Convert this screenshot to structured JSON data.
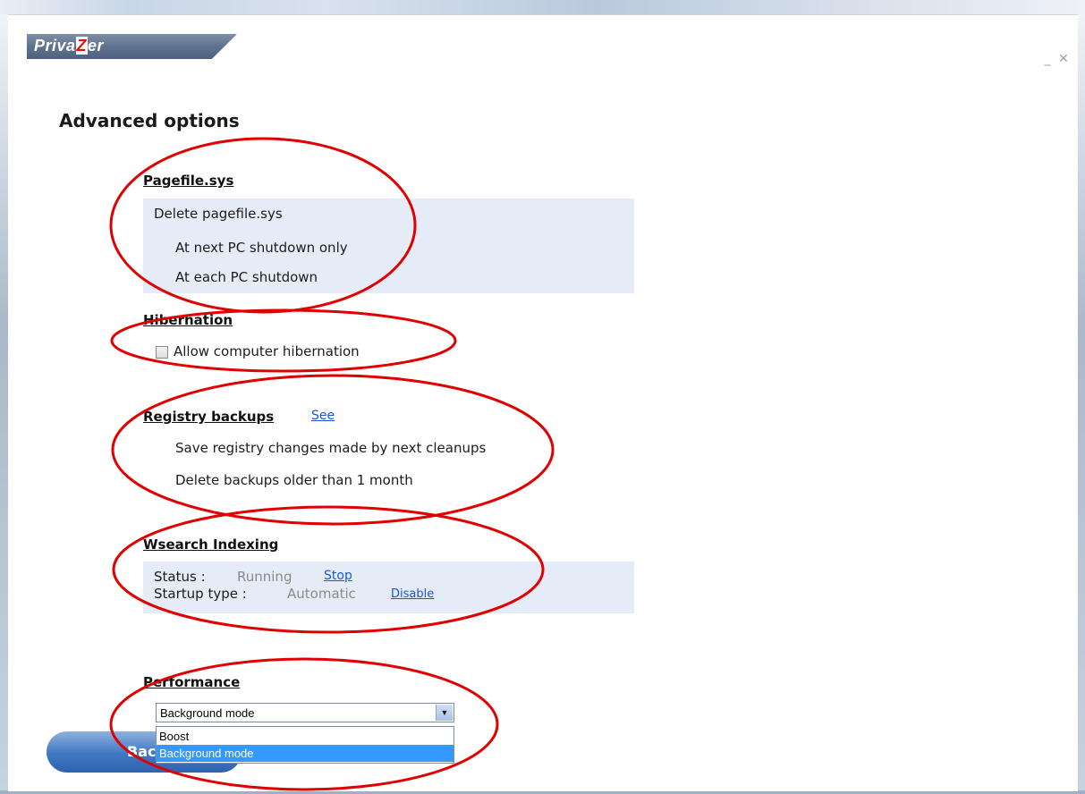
{
  "app": {
    "logo_text_1": "Priva",
    "logo_text_z": "Z",
    "logo_text_2": "er"
  },
  "window_controls": {
    "minimize": "_",
    "close": "✕"
  },
  "page_title": "Advanced options",
  "pagefile": {
    "title": "Pagefile.sys",
    "delete_label": "Delete pagefile.sys",
    "option_next": "At next PC shutdown only",
    "option_each": "At each PC shutdown"
  },
  "hibernation": {
    "title": "Hibernation",
    "checkbox_label": "Allow computer hibernation",
    "checked": false
  },
  "registry": {
    "title": "Registry backups",
    "see_link": "See",
    "option_save": "Save registry changes made by next cleanups",
    "option_delete": "Delete backups older than 1 month"
  },
  "wsearch": {
    "title": "Wsearch Indexing",
    "status_label": "Status :",
    "status_value": "Running",
    "stop_link": "Stop",
    "startup_label": "Startup type :",
    "startup_value": "Automatic",
    "disable_link": "Disable"
  },
  "performance": {
    "title": "Performance",
    "selected": "Background mode",
    "options": [
      "Boost",
      "Background mode"
    ]
  },
  "back_button": "Back",
  "colors": {
    "highlight_ring": "#e00000",
    "link": "#1a55d6",
    "shaded_bg": "#e6ecf7",
    "selected_bg": "#3399ff"
  }
}
